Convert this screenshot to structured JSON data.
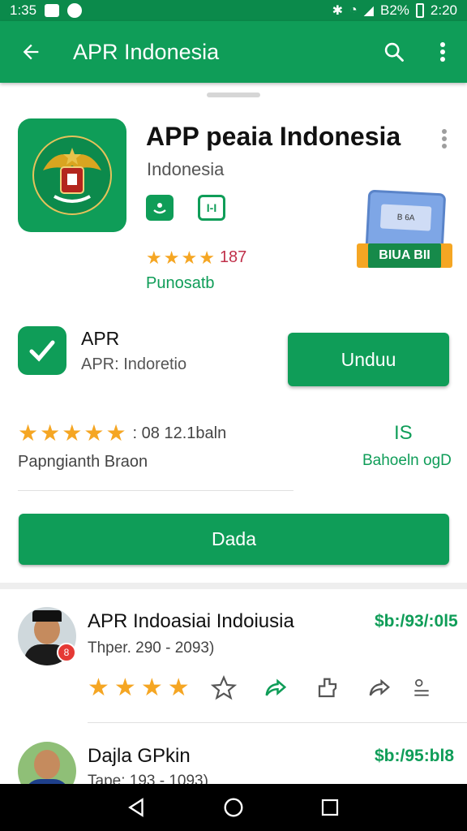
{
  "status_bar": {
    "time_left": "1:35",
    "battery_text": "B2%",
    "time_right": "2:20"
  },
  "app_bar": {
    "title": "APR Indonesia"
  },
  "app": {
    "title": "APP peaia Indonesia",
    "developer": "Indonesia",
    "badge_text": "I-I",
    "rating_count": "187",
    "publisher": "Punosatb",
    "promo_card_text": "B 6A",
    "promo_ribbon": "BIUA BII",
    "stars": 4.5
  },
  "install": {
    "name": "APR",
    "subtitle": "APR: Indoretio",
    "button_label": "Unduu"
  },
  "rating": {
    "stars": 4.5,
    "meta": ": 08 12.1baln",
    "sub": "Papngianth Braon",
    "green_mark": "IS",
    "green_sub": "Bahoeln ogD"
  },
  "wide_button_label": "Dada",
  "reviews": [
    {
      "title": "APR Indoasiai Indoiusia",
      "sub": "Thper. 290 - 2093)",
      "price": "$b:/93/:0l5",
      "badge": "8",
      "stars": 4
    },
    {
      "title": "Dajla GPkin",
      "sub": "Tape: 193 - 1093)",
      "price": "$b:/95:bl8"
    }
  ],
  "colors": {
    "primary": "#0f9d58",
    "status_bar": "#0b8a4b",
    "star": "#f5a623"
  },
  "icons": [
    "back-arrow-icon",
    "search-icon",
    "more-vert-icon",
    "check-icon",
    "star-icon",
    "share-icon"
  ]
}
